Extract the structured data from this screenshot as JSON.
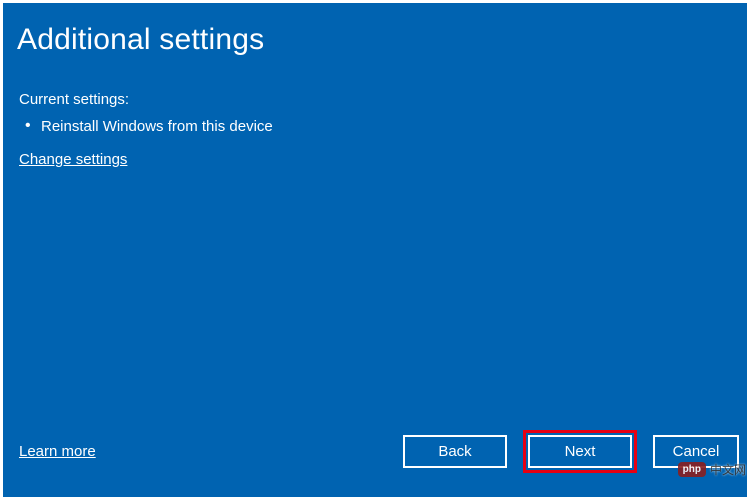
{
  "dialog": {
    "title": "Additional settings",
    "subtitle": "Current settings:",
    "bullets": [
      "Reinstall Windows from this device"
    ],
    "change_link": "Change settings",
    "learn_more": "Learn more",
    "buttons": {
      "back": "Back",
      "next": "Next",
      "cancel": "Cancel"
    }
  },
  "watermark": {
    "badge": "php",
    "text": "中文网"
  },
  "highlight": {
    "target": "next-button",
    "color": "#e60012"
  }
}
